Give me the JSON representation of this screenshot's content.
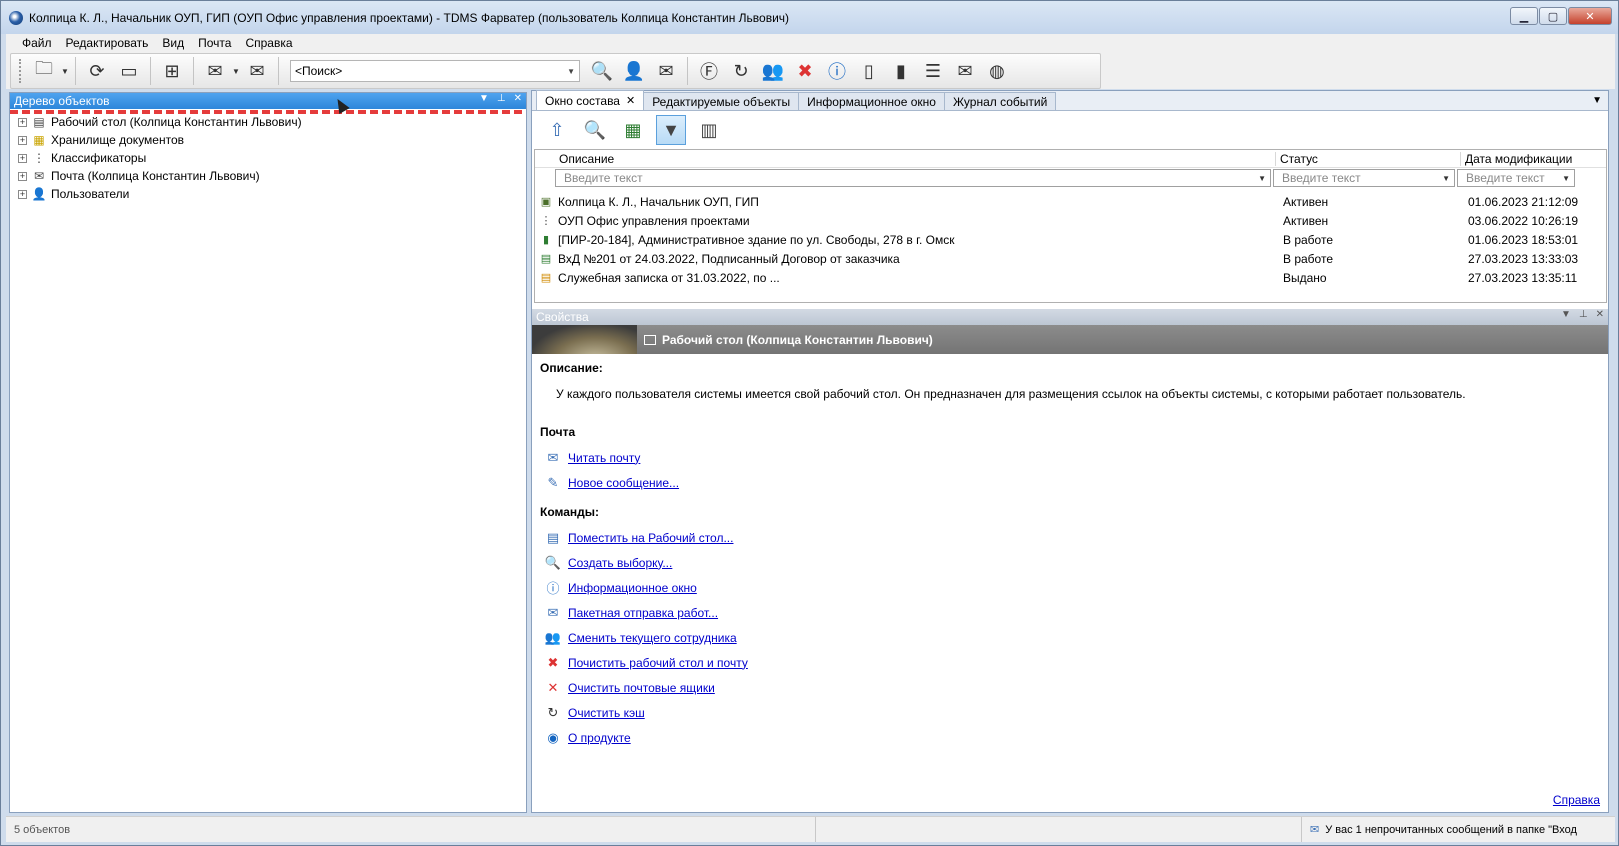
{
  "window": {
    "title": "Колпица К. Л., Начальник ОУП, ГИП (ОУП Офис управления проектами) - TDMS Фарватер (пользователь Колпица Константин Львович)"
  },
  "menu": [
    "Файл",
    "Редактировать",
    "Вид",
    "Почта",
    "Справка"
  ],
  "toolbar": {
    "search_value": "<Поиск>"
  },
  "tree": {
    "title": "Дерево объектов",
    "items": [
      {
        "label": "Рабочий стол (Колпица Константин Львович)",
        "icon": "desktop-icon"
      },
      {
        "label": "Хранилище документов",
        "icon": "storage-icon"
      },
      {
        "label": "Классификаторы",
        "icon": "classifier-icon"
      },
      {
        "label": "Почта (Колпица Константин Львович)",
        "icon": "mail-icon"
      },
      {
        "label": "Пользователи",
        "icon": "users-icon"
      }
    ]
  },
  "tabs": [
    "Окно состава",
    "Редактируемые объекты",
    "Информационное окно",
    "Журнал событий"
  ],
  "table": {
    "headers": [
      "Описание",
      "Статус",
      "Дата модификации"
    ],
    "filter_placeholder": "Введите текст",
    "rows": [
      {
        "desc": "Колпица К. Л., Начальник ОУП, ГИП",
        "status": "Активен",
        "date": "01.06.2023 21:12:09"
      },
      {
        "desc": "ОУП Офис управления проектами",
        "status": "Активен",
        "date": "03.06.2022 10:26:19"
      },
      {
        "desc": "[ПИР-20-184], Административное здание по ул. Свободы, 278 в г. Омск",
        "status": "В работе",
        "date": "01.06.2023 18:53:01"
      },
      {
        "desc": "ВхД №201 от 24.03.2022, Подписанный Договор от заказчика",
        "status": "В работе",
        "date": "27.03.2023 13:33:03"
      },
      {
        "desc": "Служебная записка от 31.03.2022, по ...",
        "status": "Выдано",
        "date": "27.03.2023 13:35:11"
      }
    ]
  },
  "properties": {
    "title": "Свойства",
    "banner": "Рабочий стол (Колпица Константин Львович)",
    "desc_title": "Описание:",
    "desc_text": "У каждого пользователя системы имеется свой рабочий стол. Он предназначен для размещения ссылок на объекты системы, с которыми работает пользователь.",
    "mail_title": "Почта",
    "mail_links": [
      "Читать почту",
      "Новое сообщение..."
    ],
    "cmd_title": "Команды:",
    "cmd_links": [
      "Поместить на Рабочий стол...",
      "Создать выборку...",
      "Информационное окно",
      "Пакетная отправка работ...",
      "Сменить текущего сотрудника",
      "Почистить рабочий стол и почту",
      "Очистить почтовые ящики",
      "Очистить кэш",
      "О продукте"
    ],
    "help": "Справка"
  },
  "status": {
    "count": "5 объектов",
    "message": "У вас 1 непрочитанных сообщений в папке \"Вход"
  }
}
